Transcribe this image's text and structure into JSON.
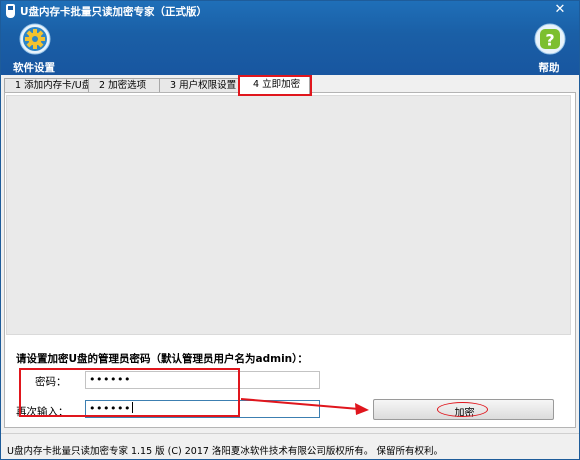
{
  "window": {
    "title": "U盘内存卡批量只读加密专家（正式版）",
    "close_glyph": "✕"
  },
  "toolbar": {
    "settings_label": "软件设置",
    "settings_icon": "gear-icon",
    "help_label": "帮助",
    "help_icon": "question-icon"
  },
  "tabs": [
    {
      "label": "1 添加内存卡/U盘"
    },
    {
      "label": "2 加密选项"
    },
    {
      "label": "3 用户权限设置"
    },
    {
      "label": "4 立即加密",
      "active": true
    }
  ],
  "form": {
    "title": "请设置加密U盘的管理员密码（默认管理员用户名为admin）：",
    "password_label": "密码：",
    "password_value": "••••••",
    "confirm_label": "再次输入：",
    "confirm_value": "••••••"
  },
  "encrypt_button": {
    "label": "加密"
  },
  "statusbar": {
    "text": "U盘内存卡批量只读加密专家 1.15 版  (C)  2017 洛阳夏冰软件技术有限公司版权所有。 保留所有权利。"
  },
  "colors": {
    "header_blue": "#1a5fa6",
    "annotation_red": "#e0161d"
  }
}
